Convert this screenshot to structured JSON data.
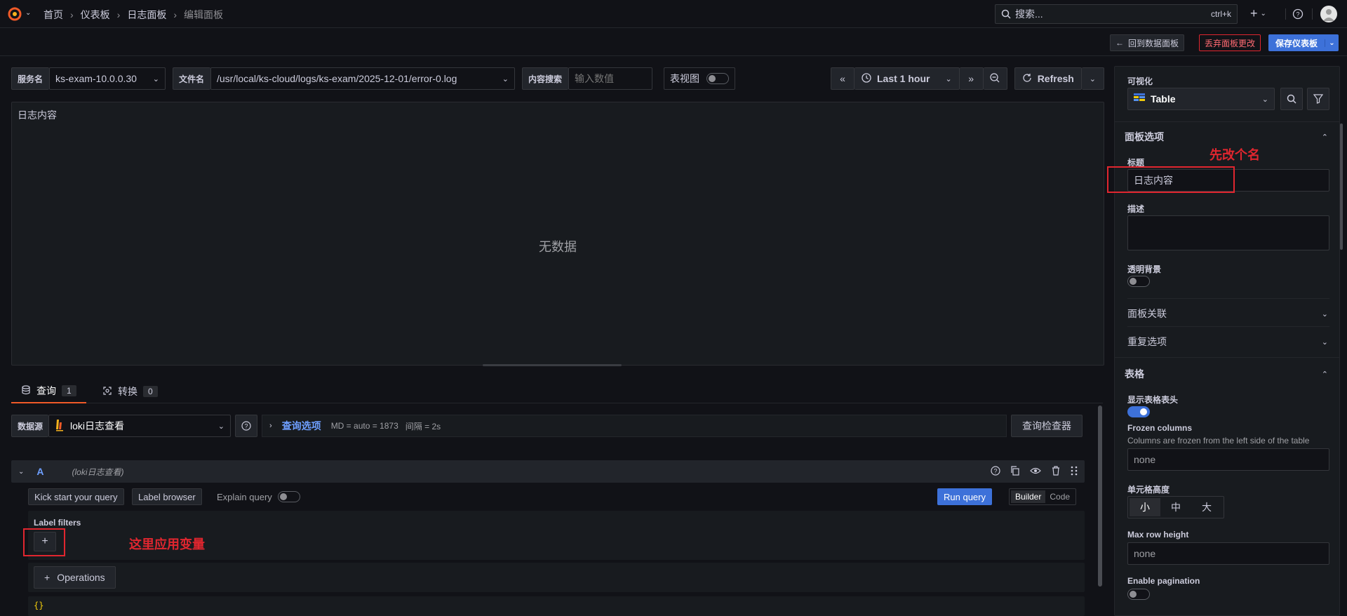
{
  "breadcrumb": {
    "home": "首页",
    "dashboards": "仪表板",
    "log_panel": "日志面板",
    "current": "编辑面板"
  },
  "topbar": {
    "search_placeholder": "搜索...",
    "search_shortcut": "ctrl+k",
    "plus": "+"
  },
  "actionbar": {
    "back": "回到数据面板",
    "discard": "丢弃面板更改",
    "save": "保存仪表板"
  },
  "vars": {
    "service_label": "服务名",
    "service_value": "ks-exam-10.0.0.30",
    "file_label": "文件名",
    "file_value": "/usr/local/ks-cloud/logs/ks-exam/2025-12-01/error-0.log",
    "search_label": "内容搜索",
    "search_placeholder": "输入数值",
    "table_view_label": "表视图"
  },
  "timepicker": {
    "range": "Last 1 hour",
    "refresh": "Refresh"
  },
  "panel": {
    "title": "日志内容",
    "no_data": "无数据"
  },
  "tabs": {
    "query_label": "查询",
    "query_count": "1",
    "transform_label": "转换",
    "transform_count": "0"
  },
  "datasource": {
    "label": "数据源",
    "value": "loki日志查看",
    "query_options": "查询选项",
    "md": "MD = auto = 1873",
    "interval": "间隔 = 2s",
    "inspector": "查询检查器"
  },
  "query": {
    "letter": "A",
    "ds_name": "(loki日志查看)",
    "kick_start": "Kick start your query",
    "label_browser": "Label browser",
    "explain": "Explain query",
    "run": "Run query",
    "builder": "Builder",
    "code": "Code",
    "label_filters": "Label filters",
    "operations": "Operations",
    "code_preview": "{}"
  },
  "annotations": {
    "rename": "先改个名",
    "variable": "这里应用变量"
  },
  "options": {
    "viz_label": "可视化",
    "viz_value": "Table",
    "panel_options": "面板选项",
    "title_label": "标题",
    "title_value": "日志内容",
    "desc_label": "描述",
    "transparent_label": "透明背景",
    "links": "面板关联",
    "repeat": "重复选项",
    "table_section": "表格",
    "show_header": "显示表格表头",
    "frozen_label": "Frozen columns",
    "frozen_desc": "Columns are frozen from the left side of the table",
    "frozen_placeholder": "none",
    "cell_height": "单元格高度",
    "cell_small": "小",
    "cell_medium": "中",
    "cell_large": "大",
    "max_row_height": "Max row height",
    "max_row_placeholder": "none",
    "pagination": "Enable pagination"
  },
  "colors": {
    "accent_blue": "#3d71d9",
    "danger": "#e0262f",
    "grafana_orange": "#f05a28"
  }
}
